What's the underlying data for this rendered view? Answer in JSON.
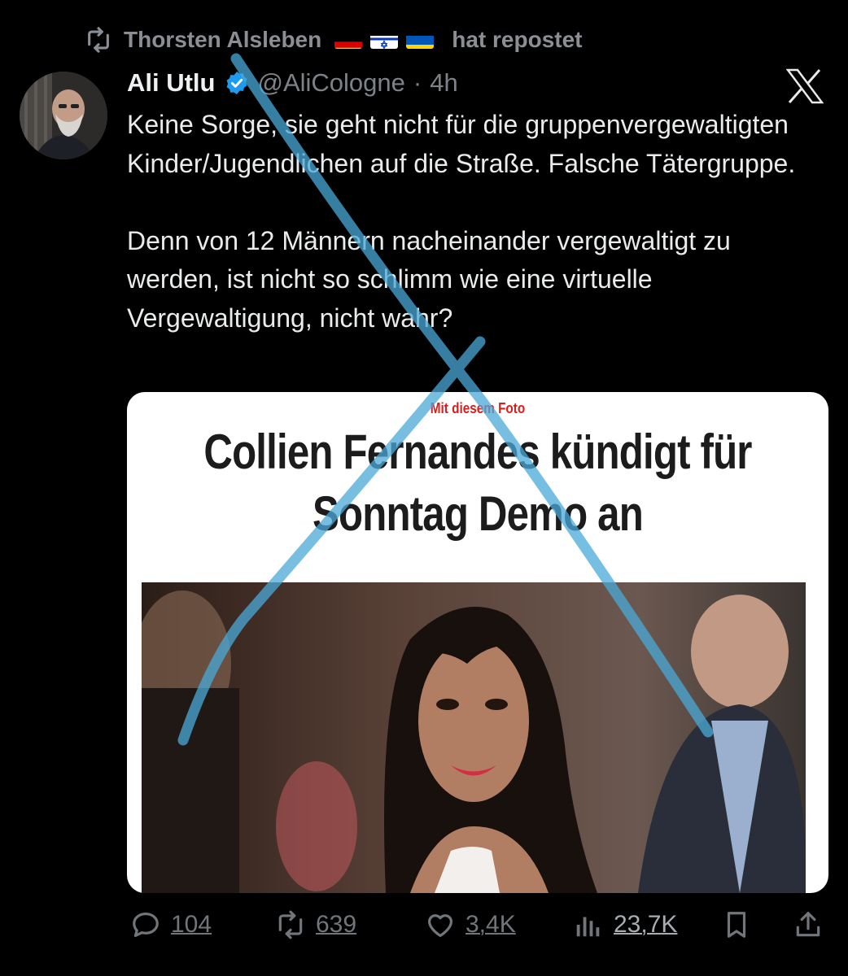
{
  "repost": {
    "icon": "repost-icon",
    "user": "Thorsten Alsleben",
    "flags": [
      "flag-germany-icon",
      "flag-israel-icon",
      "flag-ukraine-icon"
    ],
    "suffix": "hat repostet"
  },
  "author": {
    "name": "Ali Utlu",
    "verified": true,
    "handle": "@AliCologne",
    "separator": "·",
    "time": "4h"
  },
  "tweet": {
    "paragraphs": [
      "Keine Sorge, sie geht nicht für die gruppenvergewaltigten Kinder/Jugendlichen auf die Straße. Falsche Tätergruppe.",
      "Denn von 12 Männern nacheinander vergewaltigt zu werden, ist nicht so schlimm wie eine virtuelle Vergewaltigung, nicht wahr?"
    ]
  },
  "media": {
    "kicker": "Mit diesem Foto",
    "headline_line1": "Collien Fernandes kündigt für",
    "headline_line2": "Sonntag Demo an"
  },
  "actions": {
    "replies": "104",
    "reposts": "639",
    "likes": "3,4K",
    "views": "23,7K"
  },
  "colors": {
    "background": "#000000",
    "text": "#e7e9ea",
    "muted": "#71767b",
    "verified": "#1d9bf0",
    "kicker_red": "#d81e1e",
    "watermark": "#4aa9d8"
  }
}
